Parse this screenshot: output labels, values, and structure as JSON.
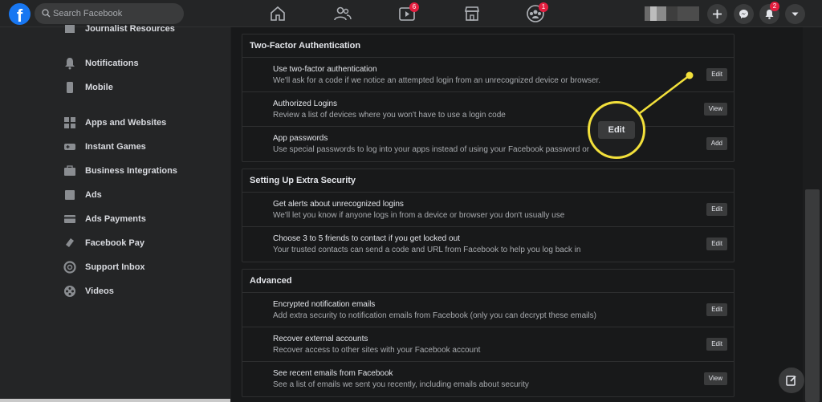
{
  "topbar": {
    "logo": "f",
    "search_placeholder": "Search Facebook",
    "badges": {
      "watch": "6",
      "groups": "1",
      "notifications": "2"
    }
  },
  "sidebar": {
    "items": [
      {
        "label": "Journalist Resources",
        "icon": "newspaper-icon"
      },
      {
        "label": "Notifications",
        "icon": "bell-icon"
      },
      {
        "label": "Mobile",
        "icon": "mobile-icon"
      },
      {
        "label": "Apps and Websites",
        "icon": "apps-icon"
      },
      {
        "label": "Instant Games",
        "icon": "gamepad-icon"
      },
      {
        "label": "Business Integrations",
        "icon": "briefcase-icon"
      },
      {
        "label": "Ads",
        "icon": "ads-icon"
      },
      {
        "label": "Ads Payments",
        "icon": "credit-card-icon"
      },
      {
        "label": "Facebook Pay",
        "icon": "pay-icon"
      },
      {
        "label": "Support Inbox",
        "icon": "lifebuoy-icon"
      },
      {
        "label": "Videos",
        "icon": "film-icon"
      }
    ]
  },
  "sections": {
    "two_factor": {
      "title": "Two-Factor Authentication",
      "rows": [
        {
          "title": "Use two-factor authentication",
          "desc": "We'll ask for a code if we notice an attempted login from an unrecognized device or browser.",
          "button": "Edit"
        },
        {
          "title": "Authorized Logins",
          "desc": "Review a list of devices where you won't have to use a login code",
          "button": "View"
        },
        {
          "title": "App passwords",
          "desc": "Use special passwords to log into your apps instead of using your Facebook password or",
          "button": "Add"
        }
      ]
    },
    "extra_security": {
      "title": "Setting Up Extra Security",
      "rows": [
        {
          "title": "Get alerts about unrecognized logins",
          "desc": "We'll let you know if anyone logs in from a device or browser you don't usually use",
          "button": "Edit"
        },
        {
          "title": "Choose 3 to 5 friends to contact if you get locked out",
          "desc": "Your trusted contacts can send a code and URL from Facebook to help you log back in",
          "button": "Edit"
        }
      ]
    },
    "advanced": {
      "title": "Advanced",
      "rows": [
        {
          "title": "Encrypted notification emails",
          "desc": "Add extra security to notification emails from Facebook (only you can decrypt these emails)",
          "button": "Edit"
        },
        {
          "title": "Recover external accounts",
          "desc": "Recover access to other sites with your Facebook account",
          "button": "Edit"
        },
        {
          "title": "See recent emails from Facebook",
          "desc": "See a list of emails we sent you recently, including emails about security",
          "button": "View"
        }
      ]
    }
  },
  "callout": {
    "label": "Edit",
    "color": "#f2e03b"
  },
  "colors": {
    "accent": "#1877f2",
    "badge": "#e41e3f",
    "highlight": "#f2e03b"
  }
}
